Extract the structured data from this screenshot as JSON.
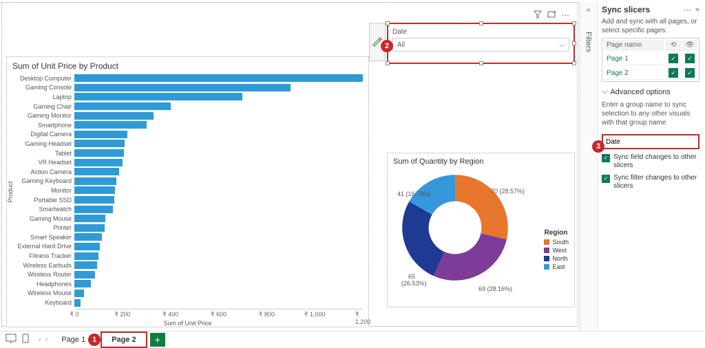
{
  "canvas": {
    "bar": {
      "title": "Sum of Unit Price by Product",
      "xlabel": "Sum of Unit Price",
      "ylabel": "Product",
      "ticks": [
        "₹ 0",
        "₹ 200",
        "₹ 400",
        "₹ 600",
        "₹ 800",
        "₹ 1,000",
        "₹ 1,200"
      ]
    },
    "donut": {
      "title": "Sum of Quantity by Region",
      "legend_header": "Region",
      "legend": [
        "South",
        "West",
        "North",
        "East"
      ],
      "labels": {
        "south": "70 (28.57%)",
        "west": "69 (28.16%)",
        "north_a": "65",
        "north_b": "(26.53%)",
        "east": "41 (16.73%)"
      }
    },
    "slicer": {
      "label": "Date",
      "value": "All"
    }
  },
  "sync": {
    "title": "Sync slicers",
    "hint": "Add and sync with all pages, or select specific pages:",
    "col": "Page name",
    "pages": [
      "Page 1",
      "Page 2"
    ],
    "adv": "Advanced options",
    "group_hint": "Enter a group name to sync selection to any other visuals with that group name",
    "group_value": "Date",
    "cb1": "Sync field changes to other slicers",
    "cb2": "Sync filter changes to other slicers"
  },
  "bottom": {
    "page1": "Page 1",
    "page2": "Page 2"
  },
  "filters_label": "Filters",
  "markers": {
    "m1": "1",
    "m2": "2",
    "m3": "3"
  },
  "chart_data": [
    {
      "type": "bar",
      "orientation": "horizontal",
      "title": "Sum of Unit Price by Product",
      "xlabel": "Sum of Unit Price",
      "ylabel": "Product",
      "xlim": [
        0,
        1200
      ],
      "currency": "₹",
      "categories": [
        "Desktop Computer",
        "Gaming Console",
        "Laptop",
        "Gaming Chair",
        "Gaming Monitor",
        "Smartphone",
        "Digital Camera",
        "Gaming Headset",
        "Tablet",
        "VR Headset",
        "Action Camera",
        "Gaming Keyboard",
        "Monitor",
        "Portable SSD",
        "Smartwatch",
        "Gaming Mouse",
        "Printer",
        "Smart Speaker",
        "External Hard Drive",
        "Fitness Tracker",
        "Wireless Earbuds",
        "Wireless Router",
        "Headphones",
        "Wireless Mouse",
        "Keyboard"
      ],
      "values": [
        1200,
        900,
        700,
        400,
        330,
        300,
        220,
        210,
        205,
        200,
        185,
        175,
        170,
        165,
        160,
        130,
        125,
        115,
        105,
        100,
        95,
        85,
        70,
        40,
        25
      ]
    },
    {
      "type": "pie",
      "subtype": "donut",
      "title": "Sum of Quantity by Region",
      "series": [
        {
          "name": "South",
          "value": 70,
          "pct": 28.57,
          "color": "#e8762c"
        },
        {
          "name": "West",
          "value": 69,
          "pct": 28.16,
          "color": "#7d3c98"
        },
        {
          "name": "North",
          "value": 65,
          "pct": 26.53,
          "color": "#1f3a93"
        },
        {
          "name": "East",
          "value": 41,
          "pct": 16.73,
          "color": "#3498db"
        }
      ]
    }
  ]
}
